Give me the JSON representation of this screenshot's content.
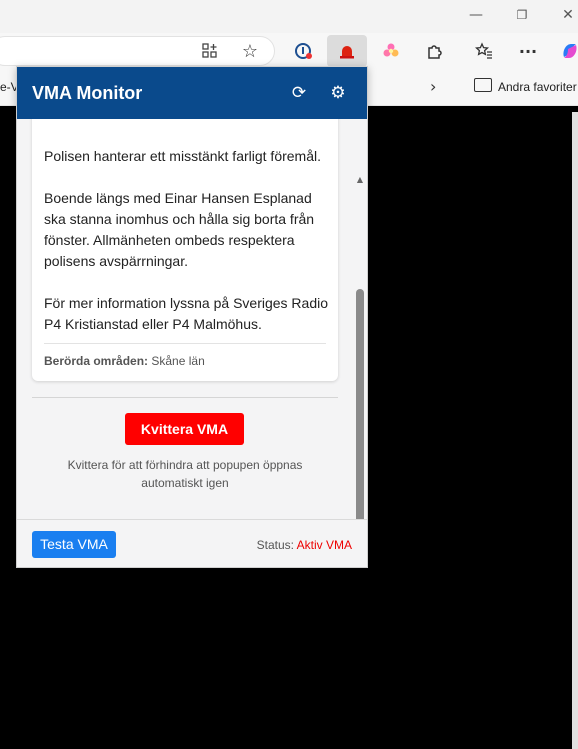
{
  "browser": {
    "favorites_truncated": "e-V",
    "favorites_folder": "Andra favoriter"
  },
  "popup": {
    "title": "VMA Monitor",
    "message": {
      "p1": "Polisen hanterar ett misstänkt farligt föremål.",
      "p2": "Boende längs med Einar Hansen Esplanad ska stanna inomhus och hålla sig borta från fönster. Allmänheten ombeds respektera polisens avspärrningar.",
      "p3": "För mer information lyssna på Sveriges Radio P4 Kristianstad eller P4 Malmöhus."
    },
    "areas_label": "Berörda områden:",
    "areas_value": "Skåne län",
    "ack_button": "Kvittera VMA",
    "ack_hint": "Kvittera för att förhindra att popupen öppnas automatiskt igen",
    "test_button": "Testa VMA",
    "status_label": "Status:",
    "status_value": "Aktiv VMA"
  },
  "colors": {
    "header": "#0a4a8c",
    "ack_button": "#ff0000",
    "test_button": "#1a7ff0",
    "status_active": "#ee0000"
  }
}
